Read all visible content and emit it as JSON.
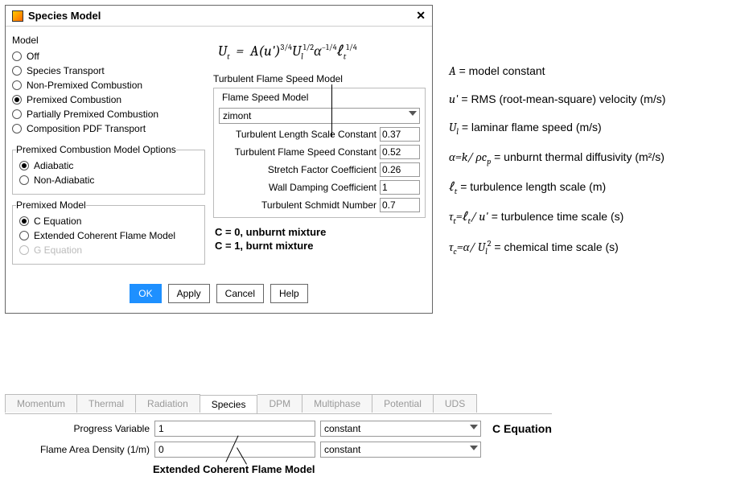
{
  "dialog": {
    "title": "Species Model",
    "model_label": "Model",
    "model_options": [
      "Off",
      "Species Transport",
      "Non-Premixed Combustion",
      "Premixed Combustion",
      "Partially Premixed Combustion",
      "Composition PDF Transport"
    ],
    "model_selected": 3,
    "pcmo_label": "Premixed Combustion Model Options",
    "pcmo_options": [
      "Adiabatic",
      "Non-Adiabatic"
    ],
    "pcmo_selected": 0,
    "pm_label": "Premixed Model",
    "pm_options": [
      "C Equation",
      "Extended Coherent Flame Model",
      "G Equation"
    ],
    "pm_selected": 0,
    "pm_disabled": [
      2
    ],
    "buttons": {
      "ok": "OK",
      "apply": "Apply",
      "cancel": "Cancel",
      "help": "Help"
    }
  },
  "flame": {
    "group_label": "Turbulent Flame Speed Model",
    "sub_label": "Flame Speed Model",
    "model_value": "zimont",
    "params": [
      {
        "label": "Turbulent Length Scale Constant",
        "value": "0.37"
      },
      {
        "label": "Turbulent Flame Speed Constant",
        "value": "0.52"
      },
      {
        "label": "Stretch Factor Coefficient",
        "value": "0.26"
      },
      {
        "label": "Wall Damping Coefficient",
        "value": "1"
      },
      {
        "label": "Turbulent Schmidt Number",
        "value": "0.7"
      }
    ],
    "c0": "C = 0, unburnt mixture",
    "c1": "C = 1, burnt mixture"
  },
  "defs": {
    "A": "= model constant",
    "uprime": "= RMS (root-mean-square) velocity (m/s)",
    "Ul": "= laminar flame speed (m/s)",
    "alpha_eq": "α=k/ ρc",
    "alpha_desc": " = unburnt thermal diffusivity (m²/s)",
    "lt": "= turbulence length scale (m)",
    "taut_eq": "τ",
    "taut_desc": " = turbulence time scale (s)",
    "tauc_desc": " = chemical time scale (s)"
  },
  "tabs": {
    "items": [
      "Momentum",
      "Thermal",
      "Radiation",
      "Species",
      "DPM",
      "Multiphase",
      "Potential",
      "UDS"
    ],
    "active": 3
  },
  "panel": {
    "rows": [
      {
        "label": "Progress Variable",
        "value": "1",
        "dropdown": "constant"
      },
      {
        "label": "Flame Area Density (1/m)",
        "value": "0",
        "dropdown": "constant"
      }
    ],
    "ceq": "C Equation",
    "ecfm": "Extended Coherent Flame Model"
  }
}
